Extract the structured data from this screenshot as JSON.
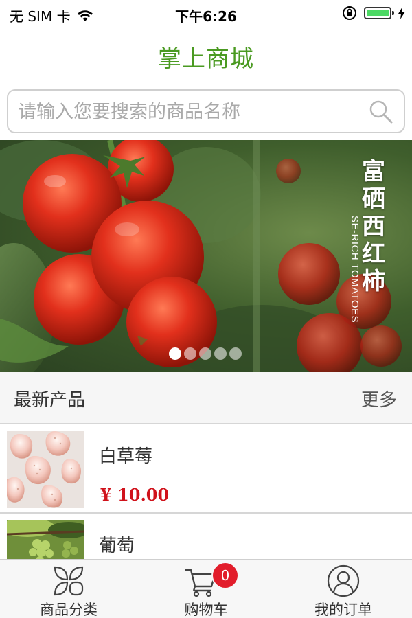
{
  "status_bar": {
    "carrier": "无 SIM 卡",
    "time": "下午6:26"
  },
  "nav": {
    "title": "掌上商城"
  },
  "search": {
    "placeholder": "请输入您要搜索的商品名称"
  },
  "banner": {
    "title": "富硒西红柿",
    "subtitle": "SE-RICH TOMATOES",
    "page_count": 5,
    "active_page": 1
  },
  "section": {
    "title": "最新产品",
    "more": "更多"
  },
  "products": [
    {
      "name": "白草莓",
      "price": "¥ 10.00"
    },
    {
      "name": "葡萄"
    }
  ],
  "tabbar": {
    "items": [
      {
        "label": "商品分类",
        "icon": "category-icon"
      },
      {
        "label": "购物车",
        "icon": "cart-icon",
        "badge": "0"
      },
      {
        "label": "我的订单",
        "icon": "user-icon"
      }
    ]
  },
  "colors": {
    "title_green": "#4a9a21",
    "price_red": "#d0121b",
    "badge_red": "#e21d2b",
    "battery_green": "#4cd964"
  }
}
